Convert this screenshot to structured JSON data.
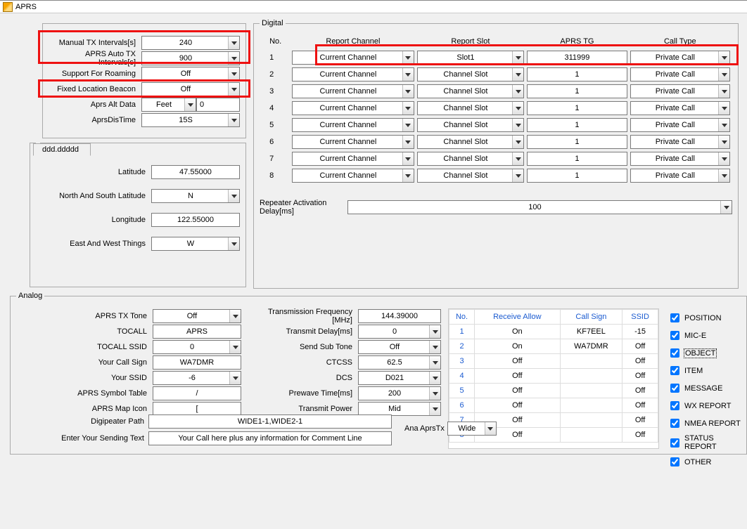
{
  "title": "APRS",
  "labels": {
    "manual_tx": "Manual TX Intervals[s]",
    "auto_tx": "APRS Auto TX Intervals[s]",
    "roaming": "Support For Roaming",
    "beacon": "Fixed Location Beacon",
    "alt_data": "Aprs Alt Data",
    "dis_time": "AprsDisTime",
    "tab": "ddd.ddddd",
    "lat": "Latitude",
    "ns": "North And South Latitude",
    "lon": "Longitude",
    "ew": "East  And West Things",
    "digital": "Digital",
    "analog": "Analog",
    "no": "No.",
    "rep_ch": "Report Channel",
    "rep_slot": "Report Slot",
    "aprs_tg": "APRS TG",
    "call_type": "Call Type",
    "rep_delay": "Repeater Activation Delay[ms]",
    "tx_tone": "APRS TX Tone",
    "tocall": "TOCALL",
    "tocall_ssid": "TOCALL SSID",
    "your_cs": "Your Call Sign",
    "your_ssid": "Your SSID",
    "symtbl": "APRS Symbol Table",
    "mapicon": "APRS Map Icon",
    "digipath": "Digipeater Path",
    "sendtext": "Enter Your Sending Text",
    "txfreq": "Transmission Frequency [MHz]",
    "txdelay": "Transmit Delay[ms]",
    "subtone": "Send Sub Tone",
    "ctcss": "CTCSS",
    "dcs": "DCS",
    "prewave": "Prewave Time[ms]",
    "txpower": "Transmit Power",
    "ana_aprs": "Ana AprsTx",
    "rcv_allow": "Receive Allow",
    "call_sign": "Call Sign",
    "ssid": "SSID"
  },
  "values": {
    "manual_tx": "240",
    "auto_tx": "900",
    "roaming": "Off",
    "beacon": "Off",
    "alt_unit": "Feet",
    "alt_value": "0",
    "dis_time": "15S",
    "lat": "47.55000",
    "ns": "N",
    "lon": "122.55000",
    "ew": "W",
    "rep_delay": "100",
    "tx_tone": "Off",
    "tocall": "APRS",
    "tocall_ssid": "0",
    "your_cs": "WA7DMR",
    "your_ssid": "-6",
    "symtbl": "/",
    "mapicon": "[",
    "digipath": "WIDE1-1,WIDE2-1",
    "sendtext": "Your Call here plus any information for Comment Line",
    "txfreq": "144.39000",
    "txdelay": "0",
    "subtone": "Off",
    "ctcss": "62.5",
    "dcs": "D021",
    "prewave": "200",
    "txpower": "Mid",
    "ana_aprs": "Wide"
  },
  "digital_rows": [
    {
      "no": "1",
      "ch": "Current Channel",
      "slot": "Slot1",
      "tg": "311999",
      "ct": "Private Call"
    },
    {
      "no": "2",
      "ch": "Current Channel",
      "slot": "Channel Slot",
      "tg": "1",
      "ct": "Private Call"
    },
    {
      "no": "3",
      "ch": "Current Channel",
      "slot": "Channel Slot",
      "tg": "1",
      "ct": "Private Call"
    },
    {
      "no": "4",
      "ch": "Current Channel",
      "slot": "Channel Slot",
      "tg": "1",
      "ct": "Private Call"
    },
    {
      "no": "5",
      "ch": "Current Channel",
      "slot": "Channel Slot",
      "tg": "1",
      "ct": "Private Call"
    },
    {
      "no": "6",
      "ch": "Current Channel",
      "slot": "Channel Slot",
      "tg": "1",
      "ct": "Private Call"
    },
    {
      "no": "7",
      "ch": "Current Channel",
      "slot": "Channel Slot",
      "tg": "1",
      "ct": "Private Call"
    },
    {
      "no": "8",
      "ch": "Current Channel",
      "slot": "Channel Slot",
      "tg": "1",
      "ct": "Private Call"
    }
  ],
  "rx_rows": [
    {
      "no": "1",
      "allow": "On",
      "cs": "KF7EEL",
      "ssid": "-15"
    },
    {
      "no": "2",
      "allow": "On",
      "cs": "WA7DMR",
      "ssid": "Off"
    },
    {
      "no": "3",
      "allow": "Off",
      "cs": "",
      "ssid": "Off"
    },
    {
      "no": "4",
      "allow": "Off",
      "cs": "",
      "ssid": "Off"
    },
    {
      "no": "5",
      "allow": "Off",
      "cs": "",
      "ssid": "Off"
    },
    {
      "no": "6",
      "allow": "Off",
      "cs": "",
      "ssid": "Off"
    },
    {
      "no": "7",
      "allow": "Off",
      "cs": "",
      "ssid": "Off"
    },
    {
      "no": "8",
      "allow": "Off",
      "cs": "",
      "ssid": "Off"
    }
  ],
  "checks": {
    "position": "POSITION",
    "mice": "MIC-E",
    "object": "OBJECT",
    "item": "ITEM",
    "message": "MESSAGE",
    "wx": "WX REPORT",
    "nmea": "NMEA REPORT",
    "status": "STATUS REPORT",
    "other": "OTHER"
  }
}
